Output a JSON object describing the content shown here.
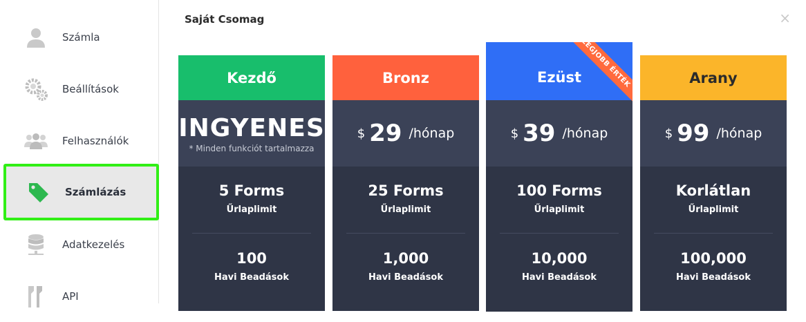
{
  "sidebar": {
    "items": [
      {
        "label": "Számla",
        "icon": "user-icon"
      },
      {
        "label": "Beállítások",
        "icon": "gears-icon"
      },
      {
        "label": "Felhasználók",
        "icon": "users-icon"
      },
      {
        "label": "Számlázás",
        "icon": "tag-icon"
      },
      {
        "label": "Adatkezelés",
        "icon": "database-icon"
      },
      {
        "label": "API",
        "icon": "key-icon"
      }
    ],
    "active_index": 3
  },
  "main": {
    "title": "Saját Csomag",
    "close_label": "×"
  },
  "plans": [
    {
      "name": "Kezdő",
      "color": "#18be6c",
      "price_text": "INGYENES",
      "price_note": "* Minden funkciót tartalmazza",
      "forms_value": "5 Forms",
      "forms_caption": "Űrlaplimit",
      "submissions_value": "100",
      "submissions_caption": "Havi Beadások"
    },
    {
      "name": "Bronz",
      "color": "#ff613d",
      "currency": "$",
      "amount": "29",
      "period": "/hónap",
      "forms_value": "25 Forms",
      "forms_caption": "Űrlaplimit",
      "submissions_value": "1,000",
      "submissions_caption": "Havi Beadások"
    },
    {
      "name": "Ezüst",
      "color": "#2f6ef6",
      "currency": "$",
      "amount": "39",
      "period": "/hónap",
      "ribbon": "LEGJOBB ÉRTÉK",
      "forms_value": "100 Forms",
      "forms_caption": "Űrlaplimit",
      "submissions_value": "10,000",
      "submissions_caption": "Havi Beadások"
    },
    {
      "name": "Arany",
      "color": "#fbb52a",
      "text_color": "#2b2b2b",
      "currency": "$",
      "amount": "99",
      "period": "/hónap",
      "forms_value": "Korlátlan",
      "forms_caption": "Űrlaplimit",
      "submissions_value": "100,000",
      "submissions_caption": "Havi Beadások"
    }
  ]
}
